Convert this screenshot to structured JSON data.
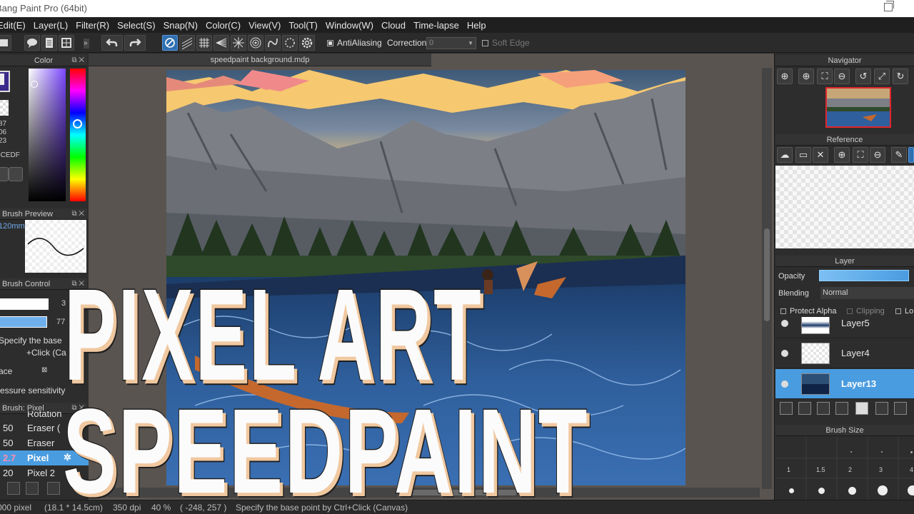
{
  "titlebar": {
    "title": "Bang Paint Pro (64bit)"
  },
  "menu": [
    "Edit(E)",
    "Layer(L)",
    "Filter(R)",
    "Select(S)",
    "Snap(N)",
    "Color(C)",
    "View(V)",
    "Tool(T)",
    "Window(W)",
    "Cloud",
    "Time-lapse",
    "Help"
  ],
  "toolbar": {
    "antialiasing_label": "AntiAliasing",
    "correction_label": "Correction",
    "correction_value": "0",
    "soft_edge_label": "Soft Edge"
  },
  "document": {
    "tab_title": "speedpaint background.mdp"
  },
  "color_panel": {
    "title": "Color",
    "rgb": [
      "87",
      "06",
      "23"
    ],
    "hex": "BCEDF"
  },
  "brush_preview": {
    "title": "Brush Preview",
    "size": "120mm"
  },
  "brush_control": {
    "title": "Brush Control",
    "value1": "3",
    "value2": "77",
    "hint_line1": "Specify the base",
    "hint_line2": "+Click (Ca",
    "space_label": "ace",
    "space_mark": "⊠",
    "sensitivity_label": "ressure sensitivity"
  },
  "brush_list": {
    "title": "Brush: Pixel",
    "partial_item": "Rotation",
    "items": [
      {
        "size": "50",
        "name": "Eraser ("
      },
      {
        "size": "50",
        "name": "Eraser"
      },
      {
        "size": "2.7",
        "name": "Pixel",
        "selected": true
      },
      {
        "size": "20",
        "name": "Pixel 2"
      }
    ]
  },
  "navigator": {
    "title": "Navigator"
  },
  "reference": {
    "title": "Reference"
  },
  "layer_panel": {
    "title": "Layer",
    "opacity_label": "Opacity",
    "blending_label": "Blending",
    "blending_value": "Normal",
    "protect_alpha_label": "Protect Alpha",
    "clipping_label": "Clipping",
    "lock_label": "Lo",
    "layers": [
      {
        "name": "Layer5"
      },
      {
        "name": "Layer4"
      },
      {
        "name": "Layer13",
        "selected": true
      }
    ]
  },
  "brush_size": {
    "title": "Brush Size",
    "labels": [
      "1",
      "1.5",
      "2",
      "3",
      "4"
    ]
  },
  "status": {
    "pixels": "000 pixel",
    "dimensions": "(18.1 * 14.5cm)",
    "dpi": "350 dpi",
    "zoom": "40 %",
    "coords": "( -248, 257 )",
    "hint": "Specify the base point by Ctrl+Click (Canvas)"
  },
  "overlay": {
    "line1": "PIXEL ART",
    "line2": "SPEEDPAINT"
  },
  "colors": {
    "accent": "#4a9ce0",
    "panel": "#2d2d2d",
    "menubar": "#1f1f1f",
    "overlay_fill": "#fbfbfb",
    "overlay_shadow": "#f0c8a0"
  }
}
